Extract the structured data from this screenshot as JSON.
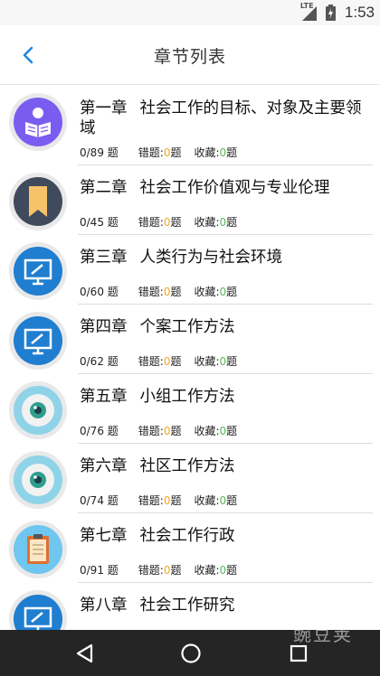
{
  "status_bar": {
    "network": "LTE",
    "time": "1:53"
  },
  "header": {
    "title": "章节列表"
  },
  "chapters": [
    {
      "num": "第一章",
      "name": "社会工作的目标、对象及主要领域",
      "progress": "0/89 题",
      "wrong_label": "错题:",
      "wrong_count": "0",
      "wrong_unit": "题",
      "fav_label": "收藏:",
      "fav_count": "0",
      "fav_unit": "题",
      "icon": "reader-icon"
    },
    {
      "num": "第二章",
      "name": "社会工作价值观与专业伦理",
      "progress": "0/45 题",
      "wrong_label": "错题:",
      "wrong_count": "0",
      "wrong_unit": "题",
      "fav_label": "收藏:",
      "fav_count": "0",
      "fav_unit": "题",
      "icon": "bookmark-icon"
    },
    {
      "num": "第三章",
      "name": "人类行为与社会环境",
      "progress": "0/60 题",
      "wrong_label": "错题:",
      "wrong_count": "0",
      "wrong_unit": "题",
      "fav_label": "收藏:",
      "fav_count": "0",
      "fav_unit": "题",
      "icon": "monitor-icon"
    },
    {
      "num": "第四章",
      "name": "个案工作方法",
      "progress": "0/62 题",
      "wrong_label": "错题:",
      "wrong_count": "0",
      "wrong_unit": "题",
      "fav_label": "收藏:",
      "fav_count": "0",
      "fav_unit": "题",
      "icon": "monitor-icon"
    },
    {
      "num": "第五章",
      "name": "小组工作方法",
      "progress": "0/76 题",
      "wrong_label": "错题:",
      "wrong_count": "0",
      "wrong_unit": "题",
      "fav_label": "收藏:",
      "fav_count": "0",
      "fav_unit": "题",
      "icon": "eye-icon"
    },
    {
      "num": "第六章",
      "name": "社区工作方法",
      "progress": "0/74 题",
      "wrong_label": "错题:",
      "wrong_count": "0",
      "wrong_unit": "题",
      "fav_label": "收藏:",
      "fav_count": "0",
      "fav_unit": "题",
      "icon": "eye-icon"
    },
    {
      "num": "第七章",
      "name": "社会工作行政",
      "progress": "0/91 题",
      "wrong_label": "错题:",
      "wrong_count": "0",
      "wrong_unit": "题",
      "fav_label": "收藏:",
      "fav_count": "0",
      "fav_unit": "题",
      "icon": "clipboard-icon"
    },
    {
      "num": "第八章",
      "name": "社会工作研究",
      "progress": "",
      "wrong_label": "",
      "wrong_count": "",
      "wrong_unit": "",
      "fav_label": "",
      "fav_count": "",
      "fav_unit": "",
      "icon": "monitor-icon"
    }
  ],
  "watermark": "豌豆荚",
  "colors": {
    "accent": "#1e88e5",
    "wrong": "#f5a623",
    "fav": "#5cb85c",
    "nav_bg": "#252525"
  }
}
